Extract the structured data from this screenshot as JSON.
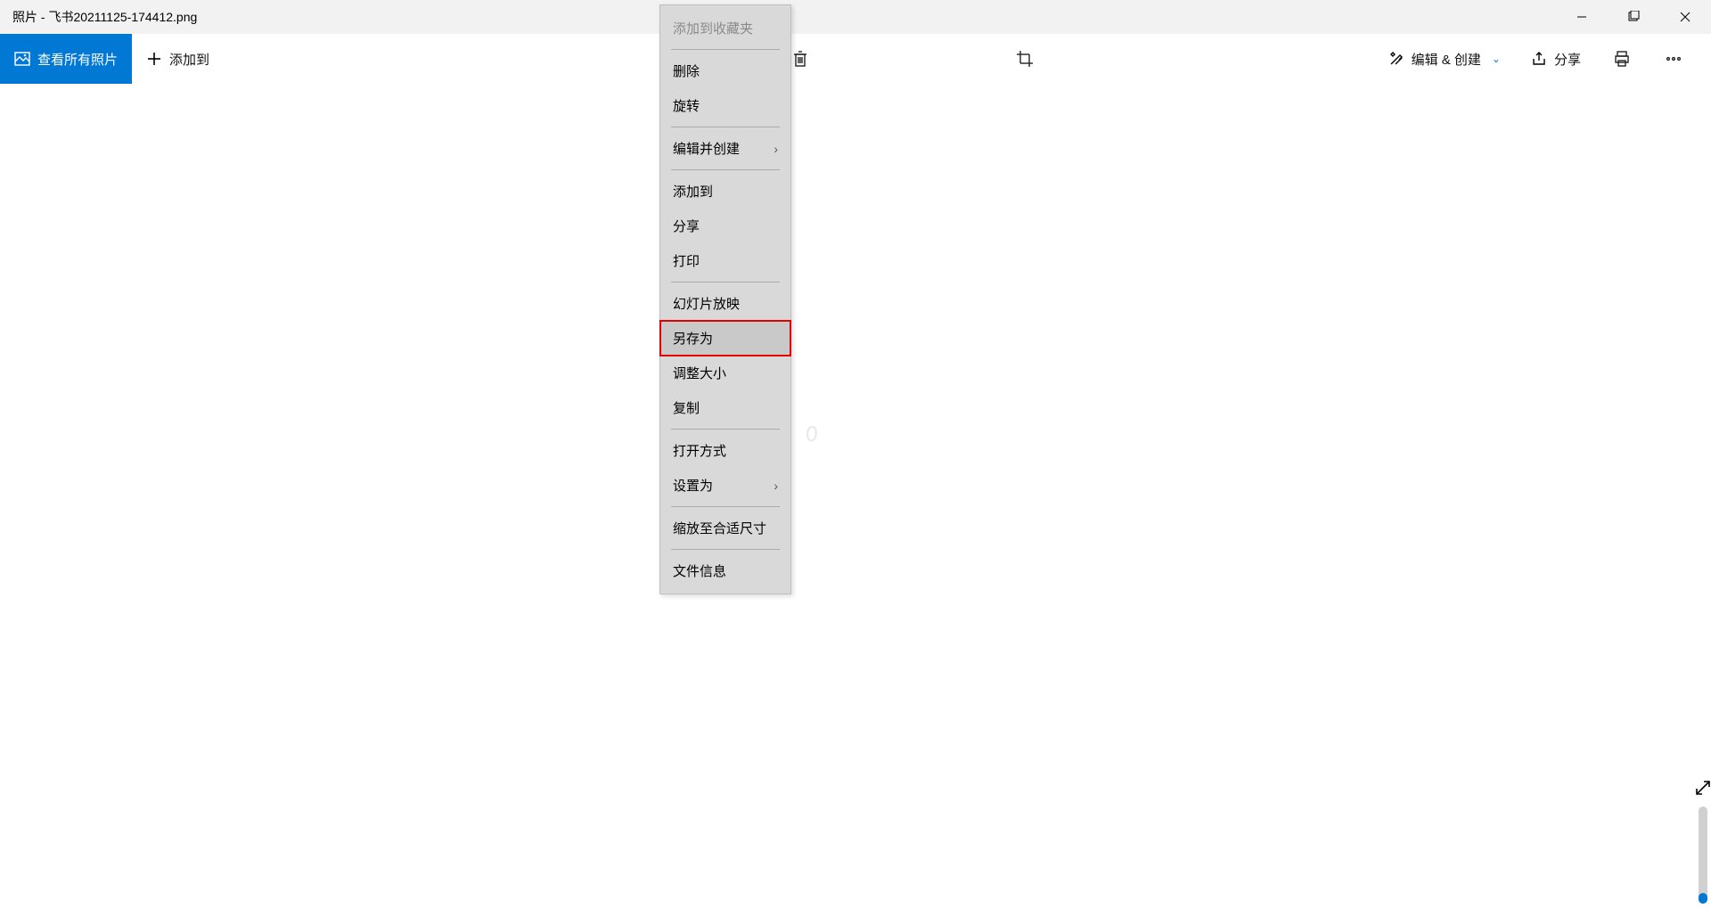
{
  "titlebar": {
    "title": "照片 - 飞书20211125-174412.png"
  },
  "toolbar": {
    "view_all": "查看所有照片",
    "add_to": "添加到",
    "edit_create": "编辑 & 创建",
    "share": "分享"
  },
  "context_menu": {
    "add_to_favorites": "添加到收藏夹",
    "delete": "删除",
    "rotate": "旋转",
    "edit_and_create": "编辑并创建",
    "add_to": "添加到",
    "share": "分享",
    "print": "打印",
    "slideshow": "幻灯片放映",
    "save_as": "另存为",
    "resize": "调整大小",
    "copy": "复制",
    "open_with": "打开方式",
    "set_as": "设置为",
    "zoom_fit": "缩放至合适尺寸",
    "file_info": "文件信息"
  },
  "watermark": "0"
}
